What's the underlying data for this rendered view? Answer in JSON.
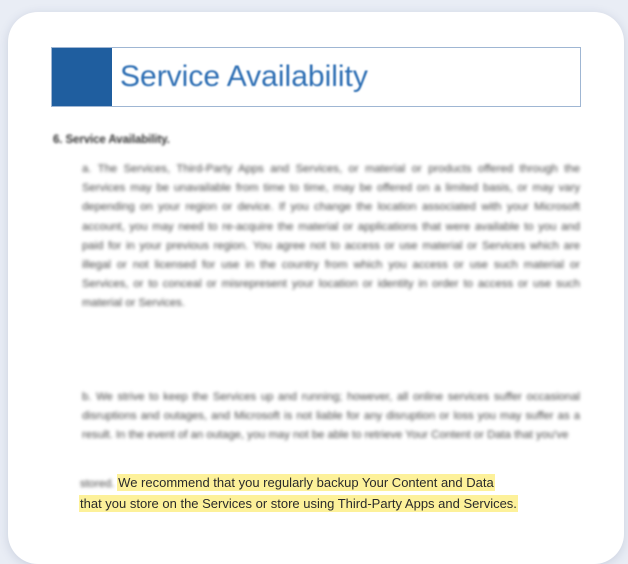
{
  "document": {
    "title": "Service Availability",
    "section_heading": "6. Service Availability.",
    "para_a": "a. The Services, Third-Party Apps and Services, or material or products offered through the Services may be unavailable from time to time, may be offered on a limited basis, or may vary depending on your region or device. If you change the location associated with your Microsoft account, you may need to re-acquire the material or applications that were available to you and paid for in your previous region. You agree not to access or use material or Services which are illegal or not licensed for use in the country from which you access or use such material or Services, or to conceal or misrepresent your location or identity in order to access or use such material or Services.",
    "para_b": "b. We strive to keep the Services up and running; however, all online services suffer occasional disruptions and outages, and Microsoft is not liable for any disruption or loss you may suffer as a result. In the event of an outage, you may not be able to retrieve Your Content or Data that you've",
    "para_b_stored": "stored.",
    "highlight_line1": "We recommend that you regularly backup Your Content and Data",
    "highlight_line2": "that you store on the Services or store using Third-Party Apps and Services."
  },
  "colors": {
    "title_block": "#1f5e9f",
    "title_text": "#2e6fb4",
    "highlight": "#fdf19a"
  }
}
